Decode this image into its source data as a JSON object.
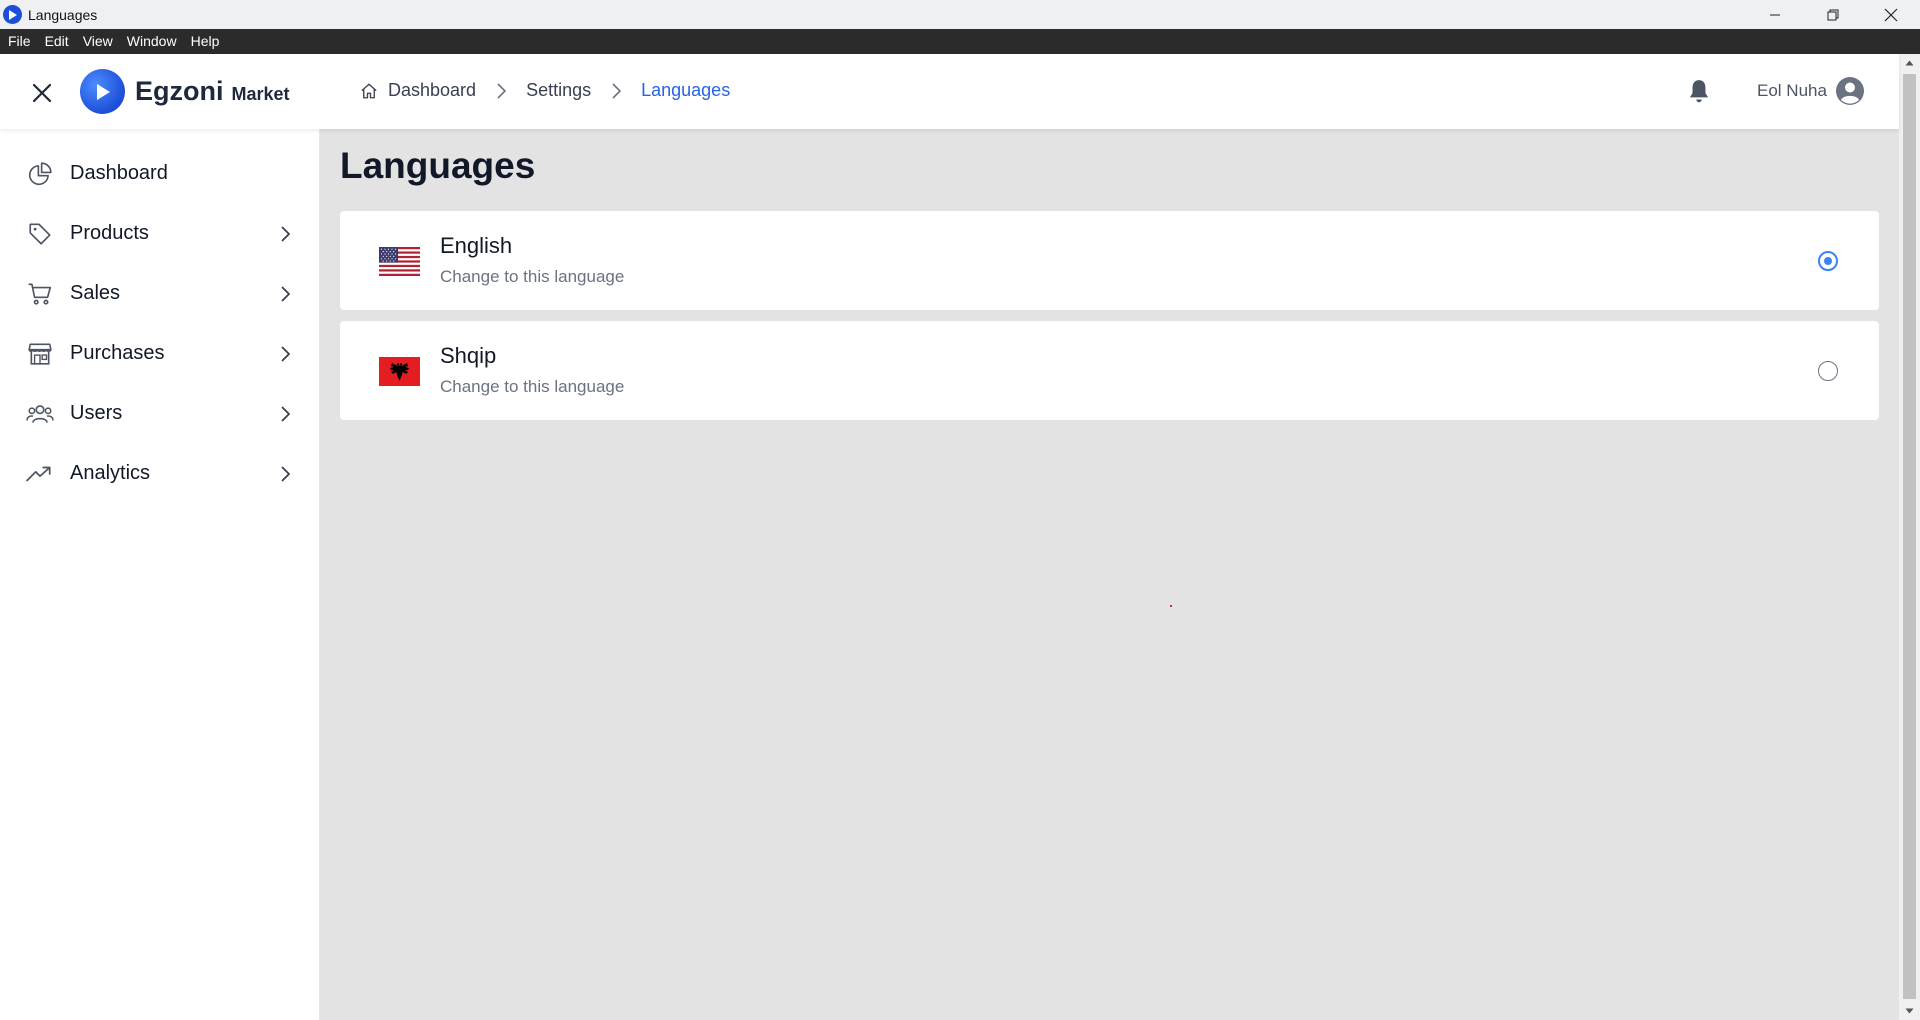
{
  "window": {
    "title": "Languages",
    "controls": [
      "minimize-icon",
      "restore-icon",
      "close-icon"
    ]
  },
  "menubar": {
    "items": [
      "File",
      "Edit",
      "View",
      "Window",
      "Help"
    ]
  },
  "header": {
    "brand_name": "Egzoni",
    "brand_sub": "Market",
    "breadcrumb": [
      {
        "label": "Dashboard",
        "icon": "home-icon"
      },
      {
        "label": "Settings"
      },
      {
        "label": "Languages",
        "active": true
      }
    ],
    "user_name": "Eol Nuha"
  },
  "sidebar": {
    "items": [
      {
        "label": "Dashboard",
        "icon": "pie-chart-icon",
        "has_children": false
      },
      {
        "label": "Products",
        "icon": "tag-icon",
        "has_children": true
      },
      {
        "label": "Sales",
        "icon": "cart-icon",
        "has_children": true
      },
      {
        "label": "Purchases",
        "icon": "store-icon",
        "has_children": true
      },
      {
        "label": "Users",
        "icon": "users-icon",
        "has_children": true
      },
      {
        "label": "Analytics",
        "icon": "trending-up-icon",
        "has_children": true
      }
    ]
  },
  "main": {
    "title": "Languages",
    "languages": [
      {
        "name": "English",
        "description": "Change to this language",
        "flag": "us-flag-icon",
        "selected": true
      },
      {
        "name": "Shqip",
        "description": "Change to this language",
        "flag": "albania-flag-icon",
        "selected": false
      }
    ]
  },
  "colors": {
    "accent": "#2563eb",
    "radio_selected": "#3b82f6",
    "content_background": "#e3e3e3",
    "menubar_background": "#2b2b2b"
  }
}
